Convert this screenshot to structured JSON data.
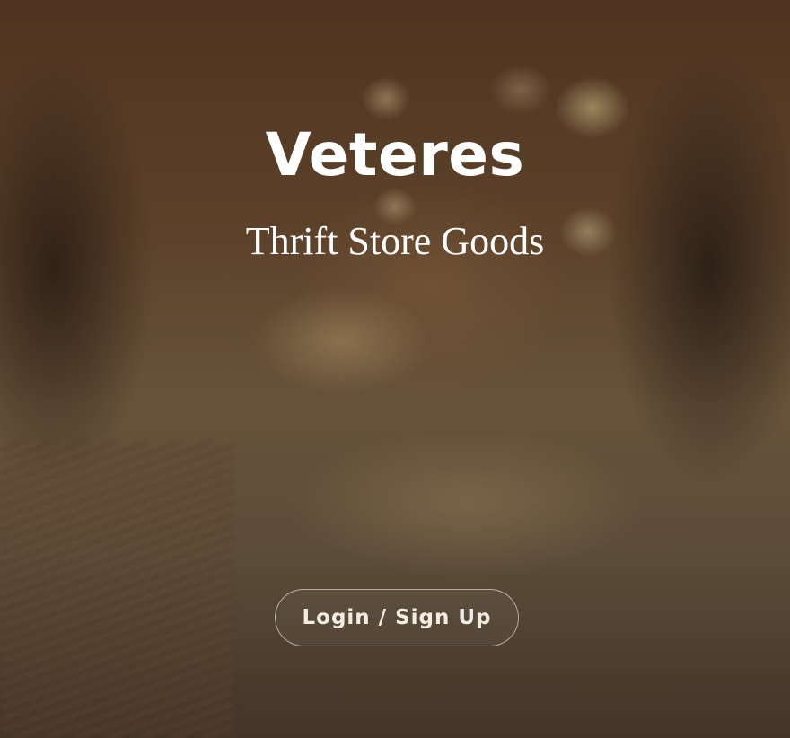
{
  "hero": {
    "title": "Veteres",
    "tagline": "Thrift Store Goods",
    "login_button_label": "Login / Sign Up"
  },
  "colors": {
    "text": "#ffffff",
    "button_border": "#c8c0b4",
    "background_tone": "#6c4c30"
  }
}
